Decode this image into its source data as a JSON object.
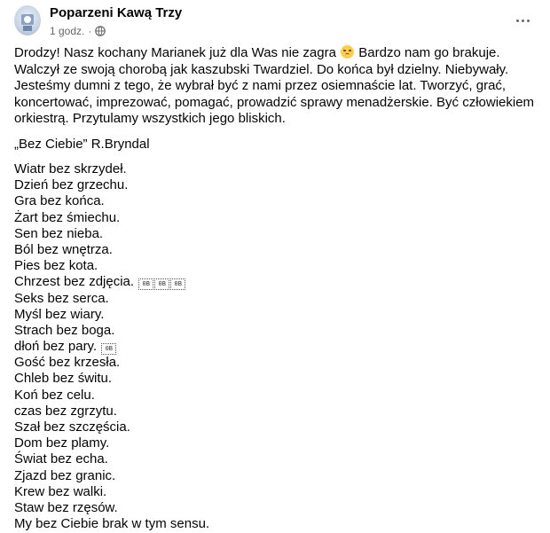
{
  "post": {
    "author": "Poparzeni Kawą Trzy",
    "time": "1 godz.",
    "separator": "·",
    "icons": {
      "avatar": "avatar",
      "visibility": "globe-icon",
      "more": "more-icon",
      "emoji": "disappointed-face-emoji"
    },
    "intro_before_emoji": "Drodzy! Nasz kochany Marianek już dla Was nie zagra ",
    "intro_after_emoji": " Bardzo nam go brakuje. Walczył ze swoją chorobą jak kaszubski Twardziel. Do końca był dzielny. Niebywały. Jesteśmy dumni z tego, że wybrał być z nami przez osiemnaście lat. Tworzyć, grać, koncertować, imprezować, pomagać, prowadzić sprawy menadżerskie. Być człowiekiem orkiestrą. Przytulamy wszystkich jego bliskich.",
    "subtitle": "„Bez Ciebie” R.Bryndal",
    "poem": [
      "Wiatr bez skrzydeł.",
      "Dzień bez grzechu.",
      "Gra bez końca.",
      "Żart bez śmiechu.",
      "Sen bez nieba.",
      "Ból bez wnętrza.",
      "Pies bez kota.",
      "Chrzest bez zdjęcia.",
      "Seks bez serca.",
      "Myśl bez wiary.",
      "Strach bez boga.",
      "dłoń bez pary.",
      "Gość bez krzesła.",
      "Chleb bez świtu.",
      "Koń bez celu.",
      "czas bez zgrzytu.",
      "Szał bez szczęścia.",
      "Dom bez plamy.",
      "Świat bez echa.",
      "Zjazd bez granic.",
      "Krew bez walki.",
      "Staw bez rzęsów.",
      "My bez Ciebie brak w tym sensu."
    ],
    "glyph_boxes": {
      "line_8": [
        "0B",
        "0B",
        "0B"
      ],
      "line_12": [
        "0B"
      ]
    }
  }
}
